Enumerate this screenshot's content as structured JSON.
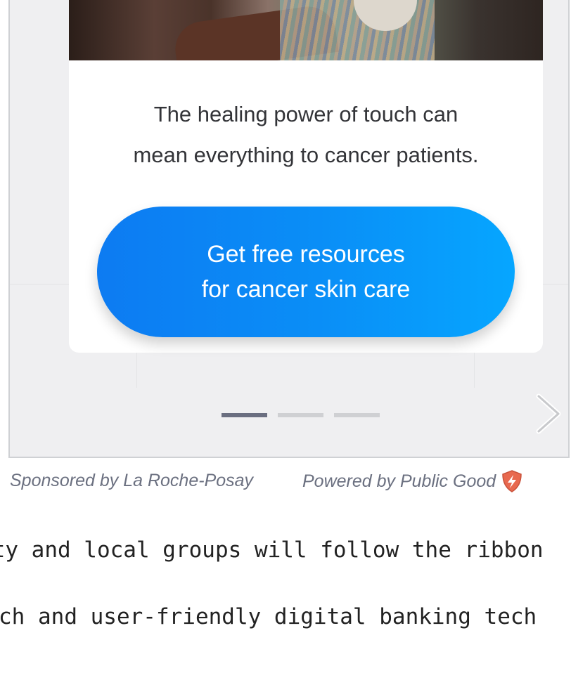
{
  "ad": {
    "headline_line1": "The healing power of touch can",
    "headline_line2": "mean everything to cancer patients.",
    "cta_line1": "Get free resources",
    "cta_line2": "for cancer skin care",
    "carousel": {
      "slide_count": 3,
      "active_index": 0
    }
  },
  "footer": {
    "sponsored": "Sponsored by La Roche-Posay",
    "powered": "Powered by Public Good"
  },
  "article": {
    "line1": "ity and local groups will follow the ribbon",
    "line2": "ch and user-friendly digital banking tech"
  },
  "colors": {
    "cta_start": "#0d7bf2",
    "cta_end": "#06a6ff",
    "dot_active": "#6a6e80",
    "dot_inactive": "#cfd0d3",
    "footer_text": "#6b7080",
    "shield": "#e8694f"
  },
  "icons": {
    "next": "chevron-right-icon",
    "brand": "public-good-shield-icon"
  }
}
